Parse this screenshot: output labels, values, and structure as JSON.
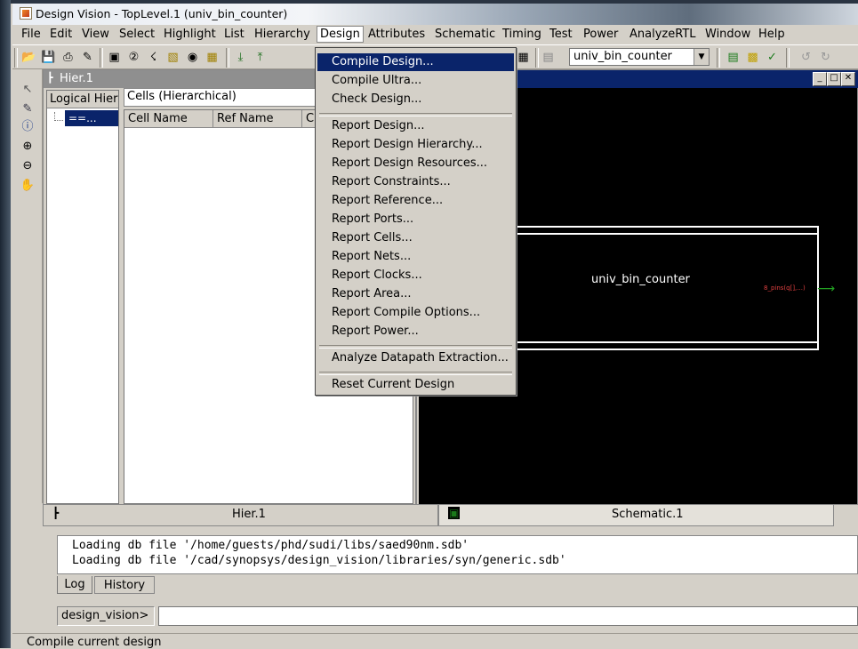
{
  "window": {
    "title": "Design Vision - TopLevel.1 (univ_bin_counter)"
  },
  "menubar": [
    "File",
    "Edit",
    "View",
    "Select",
    "Highlight",
    "List",
    "Hierarchy",
    "Design",
    "Attributes",
    "Schematic",
    "Timing",
    "Test",
    "Power",
    "AnalyzeRTL",
    "Window",
    "Help"
  ],
  "toolbar": {
    "design_selector_value": "univ_bin_counter"
  },
  "hier_window": {
    "title": "Hier.1",
    "left_header": "Logical Hier",
    "tree_node": "==...",
    "view_selector": "Cells (Hierarchical)",
    "columns": [
      "Cell Name",
      "Ref Name",
      "C"
    ]
  },
  "schematic": {
    "cell_label": "univ_bin_counter",
    "pin_label": "8_pins(q[],...)"
  },
  "tabs": {
    "hier": "Hier.1",
    "schematic": "Schematic.1"
  },
  "console": {
    "lines": [
      "Loading db file '/home/guests/phd/sudi/libs/saed90nm.sdb'",
      "Loading db file '/cad/synopsys/design_vision/libraries/syn/generic.sdb'"
    ],
    "tab_log": "Log",
    "tab_history": "History",
    "prompt": "design_vision>",
    "command_value": ""
  },
  "status": "Compile current design",
  "design_menu": {
    "group1": [
      "Compile Design...",
      "Compile Ultra...",
      "Check Design..."
    ],
    "group2": [
      "Report Design...",
      "Report Design Hierarchy...",
      "Report Design Resources...",
      "Report Constraints...",
      "Report Reference...",
      "Report Ports...",
      "Report Cells...",
      "Report Nets...",
      "Report Clocks...",
      "Report Area...",
      "Report Compile Options...",
      "Report Power..."
    ],
    "group3": [
      "Analyze Datapath Extraction..."
    ],
    "group4": [
      "Reset Current Design"
    ]
  },
  "colors": {
    "selection": "#0a246a",
    "chrome": "#d4d0c8",
    "canvas": "#000000",
    "pin_arrow": "#22a022"
  }
}
